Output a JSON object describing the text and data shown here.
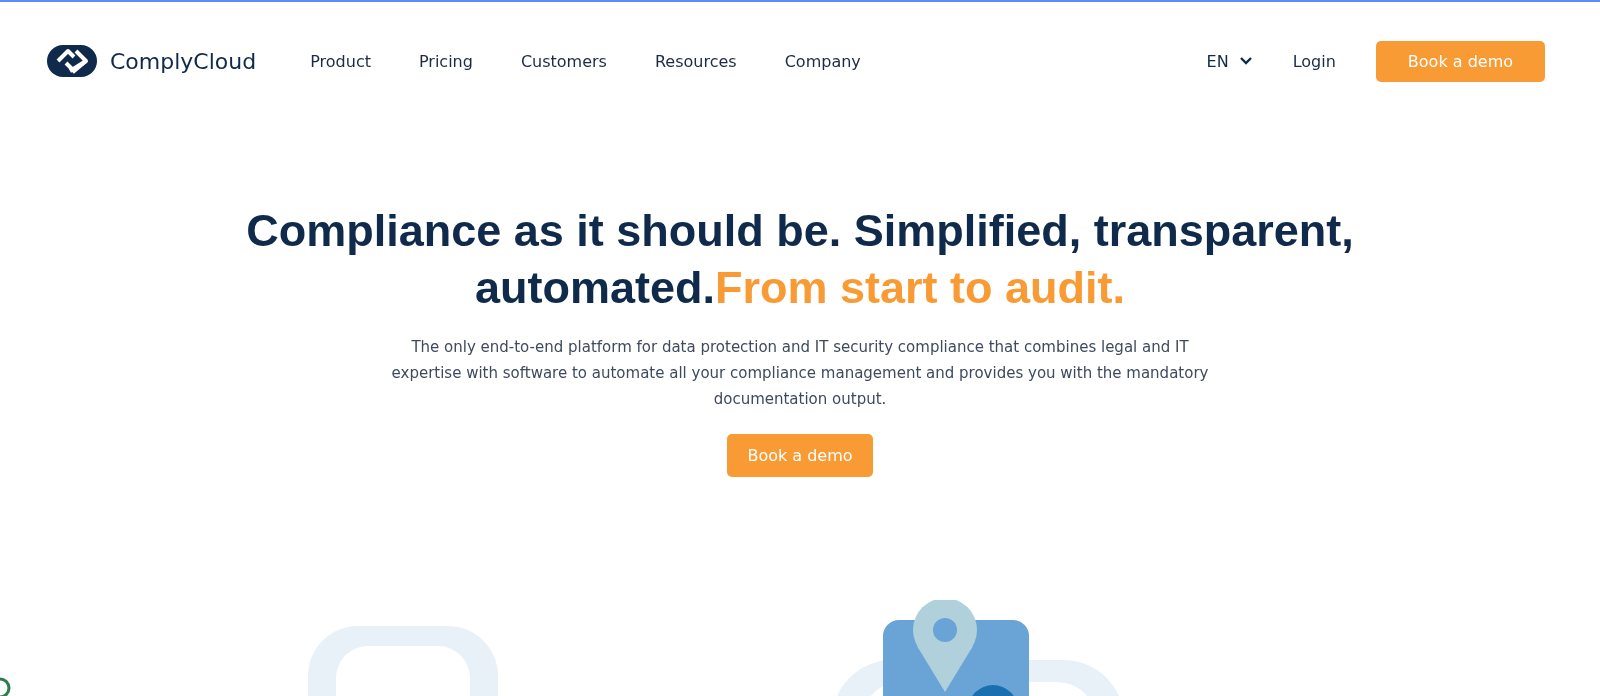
{
  "brand": {
    "name": "ComplyCloud"
  },
  "nav": [
    {
      "label": "Product"
    },
    {
      "label": "Pricing"
    },
    {
      "label": "Customers"
    },
    {
      "label": "Resources"
    },
    {
      "label": "Company"
    }
  ],
  "language": {
    "label": "EN"
  },
  "login": "Login",
  "header_cta": "Book a demo",
  "hero": {
    "headline_lines": [
      {
        "text": "Compliance as it should be. Simplified, transparent,",
        "accent": false
      },
      {
        "text": "automated.",
        "accent": false
      },
      {
        "text": "From start to audit.",
        "accent": true
      }
    ],
    "description": "The only end-to-end platform for data protection and IT security compliance that combines legal and IT expertise with software to automate all your compliance management and provides you with the mandatory documentation output.",
    "cta": "Book a demo"
  }
}
